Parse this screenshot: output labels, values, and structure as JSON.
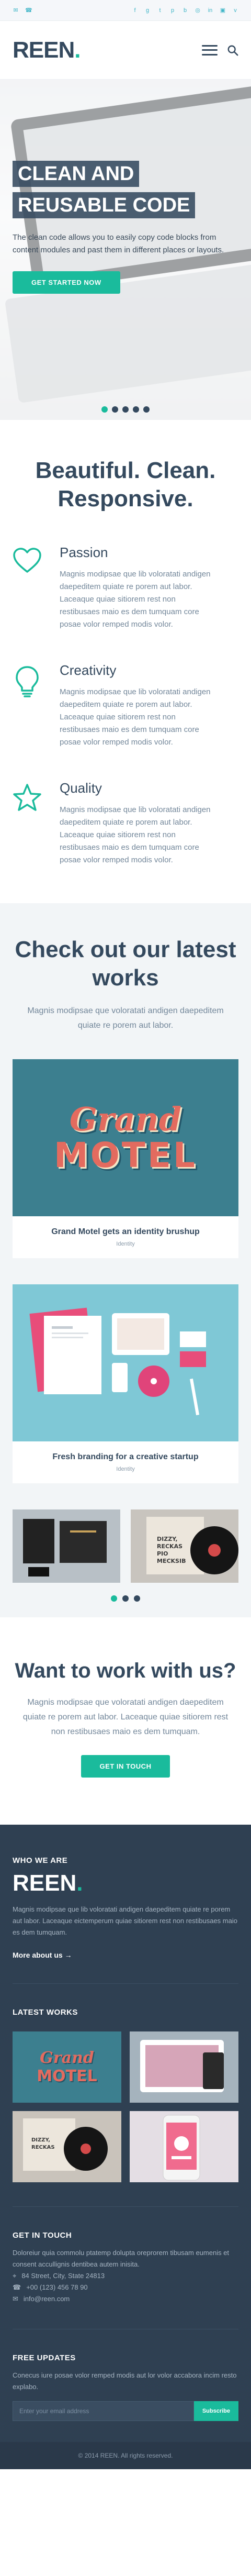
{
  "topbar": {
    "left_icons": [
      "envelope-icon",
      "phone-icon"
    ],
    "social_icons": [
      "facebook-icon",
      "google-plus-icon",
      "twitter-icon",
      "pinterest-icon",
      "behance-icon",
      "dribbble-icon",
      "linkedin-icon",
      "instagram-icon",
      "vimeo-icon"
    ]
  },
  "brand": {
    "name": "REEN",
    "dot": "."
  },
  "hero": {
    "title": "Clean and Reusable Code",
    "text": "The clean code allows you to easily copy code blocks from content modules and past them in different places or layouts.",
    "button": "Get started now",
    "slides": 5,
    "active_slide": 1
  },
  "features": {
    "heading": "Beautiful. Clean. Responsive.",
    "items": [
      {
        "title": "Passion",
        "icon": "heart-icon",
        "text": "Magnis modipsae que lib voloratati andigen daepeditem quiate re porem aut labor. Laceaque quiae sitiorem rest non restibusaes maio es dem tumquam core posae volor remped modis volor."
      },
      {
        "title": "Creativity",
        "icon": "lightbulb-icon",
        "text": "Magnis modipsae que lib voloratati andigen daepeditem quiate re porem aut labor. Laceaque quiae sitiorem rest non restibusaes maio es dem tumquam core posae volor remped modis volor."
      },
      {
        "title": "Quality",
        "icon": "star-icon",
        "text": "Magnis modipsae que lib voloratati andigen daepeditem quiate re porem aut labor. Laceaque quiae sitiorem rest non restibusaes maio es dem tumquam core posae volor remped modis volor."
      }
    ]
  },
  "works": {
    "heading": "Check out our latest works",
    "text": "Magnis modipsae que voloratati andigen daepeditem quiate re porem aut labor.",
    "motel_art": {
      "line1": "Grand",
      "line2": "MOTEL"
    },
    "cards": [
      {
        "title": "Grand Motel gets an identity brushup",
        "tag": "Identity"
      },
      {
        "title": "Fresh branding for a creative startup",
        "tag": "Identity"
      }
    ],
    "vinyl_text": "DIZZY, RECKAS PIO MECKSIB",
    "dots": 3,
    "active_dot": 0
  },
  "cta": {
    "heading": "Want to work with us?",
    "text": "Magnis modipsae que voloratati andigen daepeditem quiate re porem aut labor. Laceaque quiae sitiorem rest non restibusaes maio es dem tumquam.",
    "button": "Get in touch"
  },
  "footer": {
    "who_heading": "Who we are",
    "who_text": "Magnis modipsae que lib voloratati andigen daepeditem quiate re porem aut labor. Laceaque eictemperum quiae sitiorem rest non restibusaes maio es dem tumquam.",
    "more_link": "More about us",
    "latest_heading": "Latest works",
    "contact_heading": "Get in touch",
    "contact_text": "Doloreiur quia commolu ptatemp dolupta oreprorem tibusam eumenis et consent accullignis dentibea autem inisita.",
    "address": "84 Street, City, State 24813",
    "phone": "+00 (123) 456 78 90",
    "email": "info@reen.com",
    "updates_heading": "Free updates",
    "updates_text": "Conecus iure posae volor remped modis aut lor volor accabora incim resto explabo.",
    "email_placeholder": "Enter your email address",
    "subscribe": "Subscribe",
    "copyright": "© 2014 REEN. All rights reserved."
  }
}
